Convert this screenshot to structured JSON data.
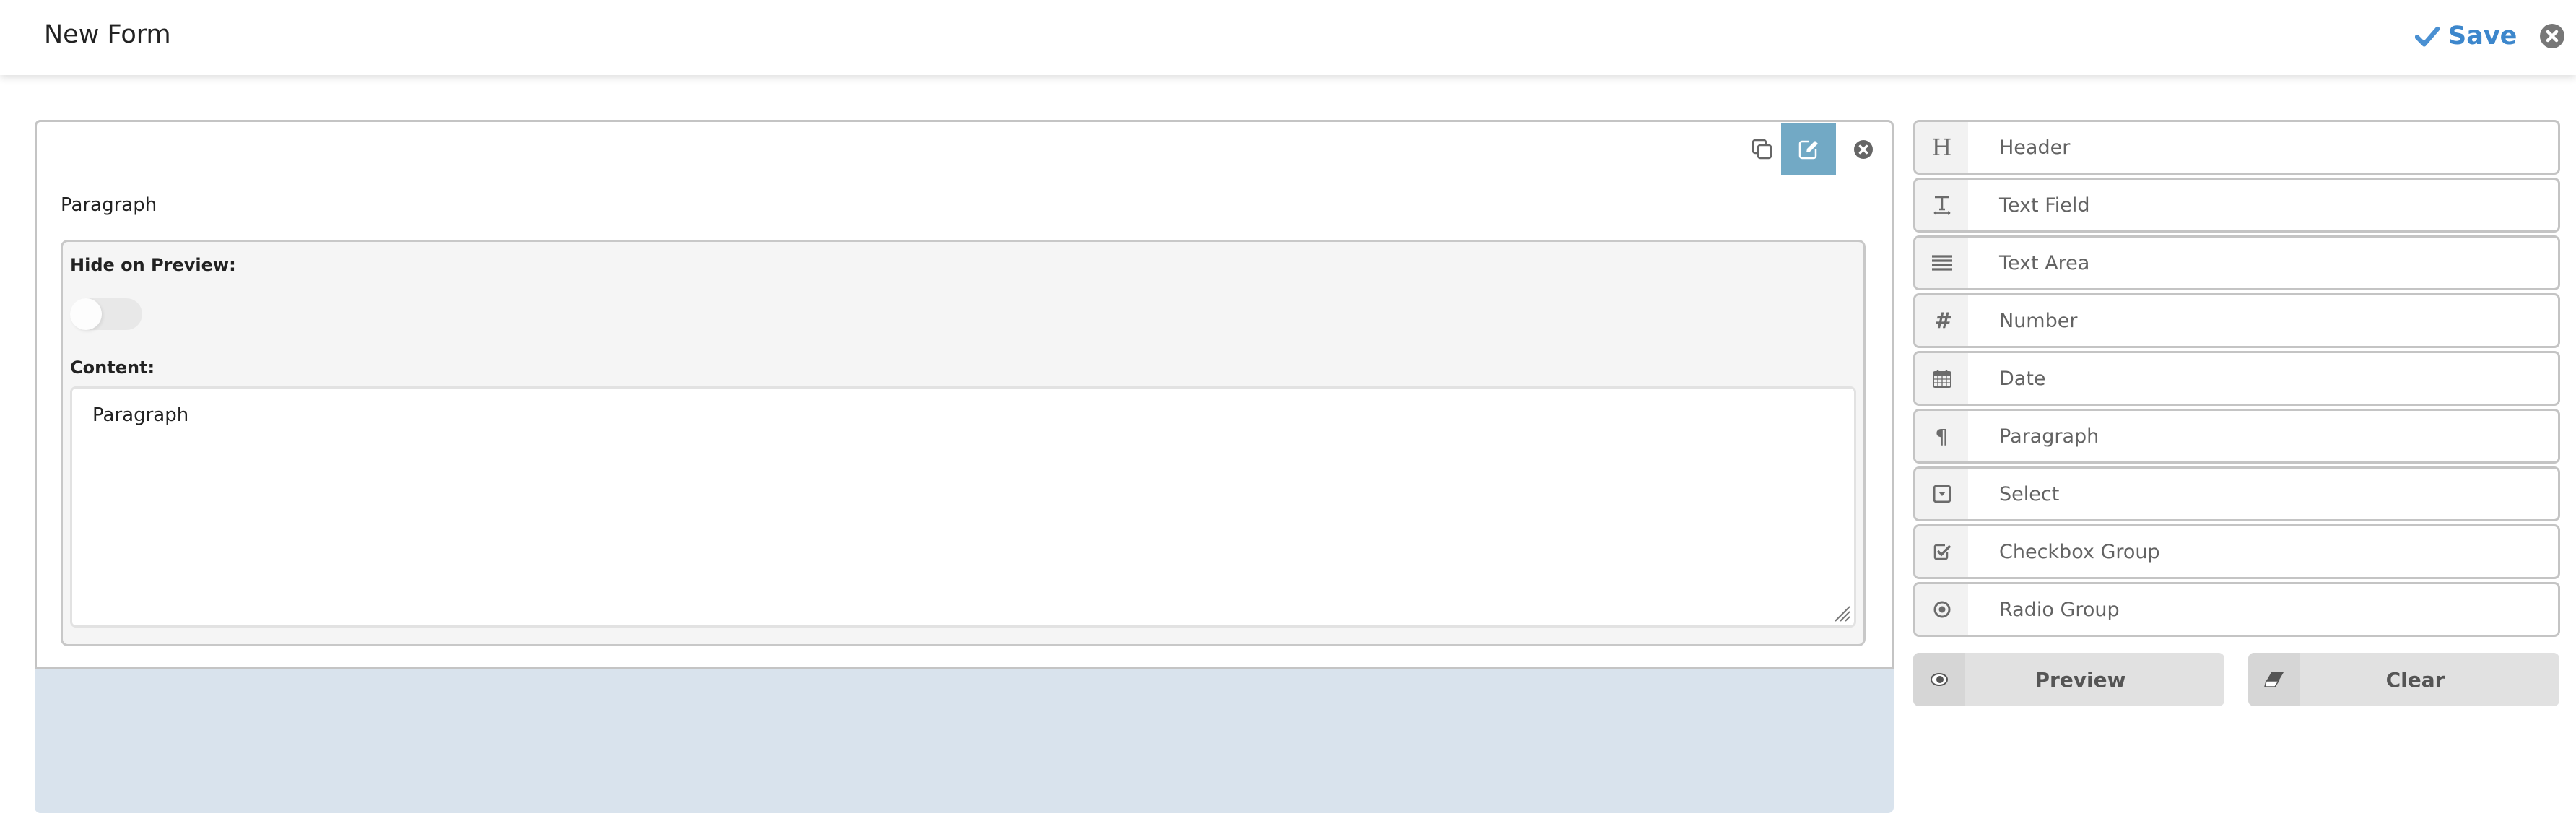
{
  "header": {
    "title": "New Form",
    "save_label": "Save",
    "save_icon": "check-icon",
    "close_icon": "close-circle-icon",
    "accent_color": "#3d87cc"
  },
  "editor": {
    "toolbar": {
      "copy_icon": "copy-icon",
      "edit_icon": "edit-icon",
      "delete_icon": "close-circle-icon",
      "edit_active_color": "#72a9c5"
    },
    "field_label": "Paragraph",
    "properties": {
      "hide_on_preview_label": "Hide on Preview:",
      "hide_on_preview_value": false,
      "content_label": "Content:",
      "content_value": "Paragraph"
    }
  },
  "palette": {
    "items": [
      {
        "label": "Header",
        "icon": "header-icon"
      },
      {
        "label": "Text Field",
        "icon": "text-field-icon"
      },
      {
        "label": "Text Area",
        "icon": "text-area-icon"
      },
      {
        "label": "Number",
        "icon": "hash-icon"
      },
      {
        "label": "Date",
        "icon": "calendar-icon"
      },
      {
        "label": "Paragraph",
        "icon": "paragraph-icon"
      },
      {
        "label": "Select",
        "icon": "select-icon"
      },
      {
        "label": "Checkbox Group",
        "icon": "checkbox-icon"
      },
      {
        "label": "Radio Group",
        "icon": "radio-icon"
      }
    ],
    "actions": {
      "preview_label": "Preview",
      "preview_icon": "eye-icon",
      "clear_label": "Clear",
      "clear_icon": "eraser-icon"
    }
  }
}
